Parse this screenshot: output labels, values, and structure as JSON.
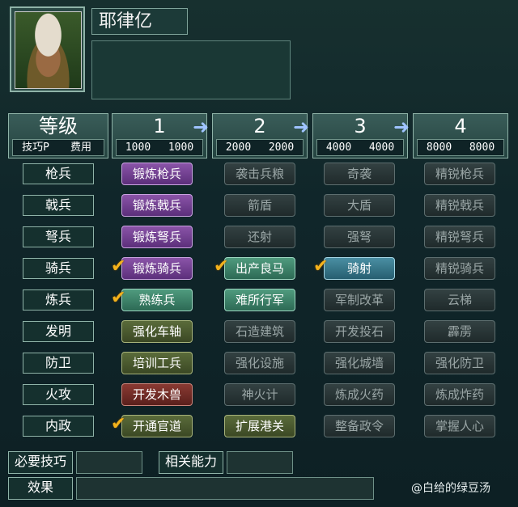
{
  "character": {
    "name": "耶律亿",
    "description": ""
  },
  "header": {
    "level_label": "等级",
    "skill_label": "技巧P",
    "cost_label": "费用",
    "levels": [
      "1",
      "2",
      "3",
      "4"
    ],
    "costs": [
      [
        "1000",
        "1000"
      ],
      [
        "2000",
        "2000"
      ],
      [
        "4000",
        "4000"
      ],
      [
        "8000",
        "8000"
      ]
    ]
  },
  "rows": [
    {
      "label": "枪兵",
      "skills": [
        "锻炼枪兵",
        "袭击兵粮",
        "奇袭",
        "精锐枪兵"
      ]
    },
    {
      "label": "戟兵",
      "skills": [
        "锻炼戟兵",
        "箭盾",
        "大盾",
        "精锐戟兵"
      ]
    },
    {
      "label": "弩兵",
      "skills": [
        "锻炼弩兵",
        "还射",
        "强弩",
        "精锐弩兵"
      ]
    },
    {
      "label": "骑兵",
      "skills": [
        "锻炼骑兵",
        "出产良马",
        "骑射",
        "精锐骑兵"
      ]
    },
    {
      "label": "炼兵",
      "skills": [
        "熟练兵",
        "难所行军",
        "军制改革",
        "云梯"
      ]
    },
    {
      "label": "发明",
      "skills": [
        "强化车轴",
        "石造建筑",
        "开发投石",
        "霹雳"
      ]
    },
    {
      "label": "防卫",
      "skills": [
        "培训工兵",
        "强化设施",
        "强化城墙",
        "强化防卫"
      ]
    },
    {
      "label": "火攻",
      "skills": [
        "开发木兽",
        "神火计",
        "炼成火药",
        "炼成炸药"
      ]
    },
    {
      "label": "内政",
      "skills": [
        "开通官道",
        "扩展港关",
        "整备政令",
        "掌握人心"
      ]
    }
  ],
  "bottom": {
    "required_skill_label": "必要技巧",
    "related_ability_label": "相关能力",
    "effect_label": "效果"
  },
  "watermark": "@白给的绿豆汤",
  "check_icon": "check-icon",
  "colors": {
    "purple": "#6e3f8f",
    "green": "#3d8068",
    "teal": "#367a8e",
    "olive": "#4a5a2e",
    "red": "#6e2c26",
    "dark": "#283435"
  }
}
